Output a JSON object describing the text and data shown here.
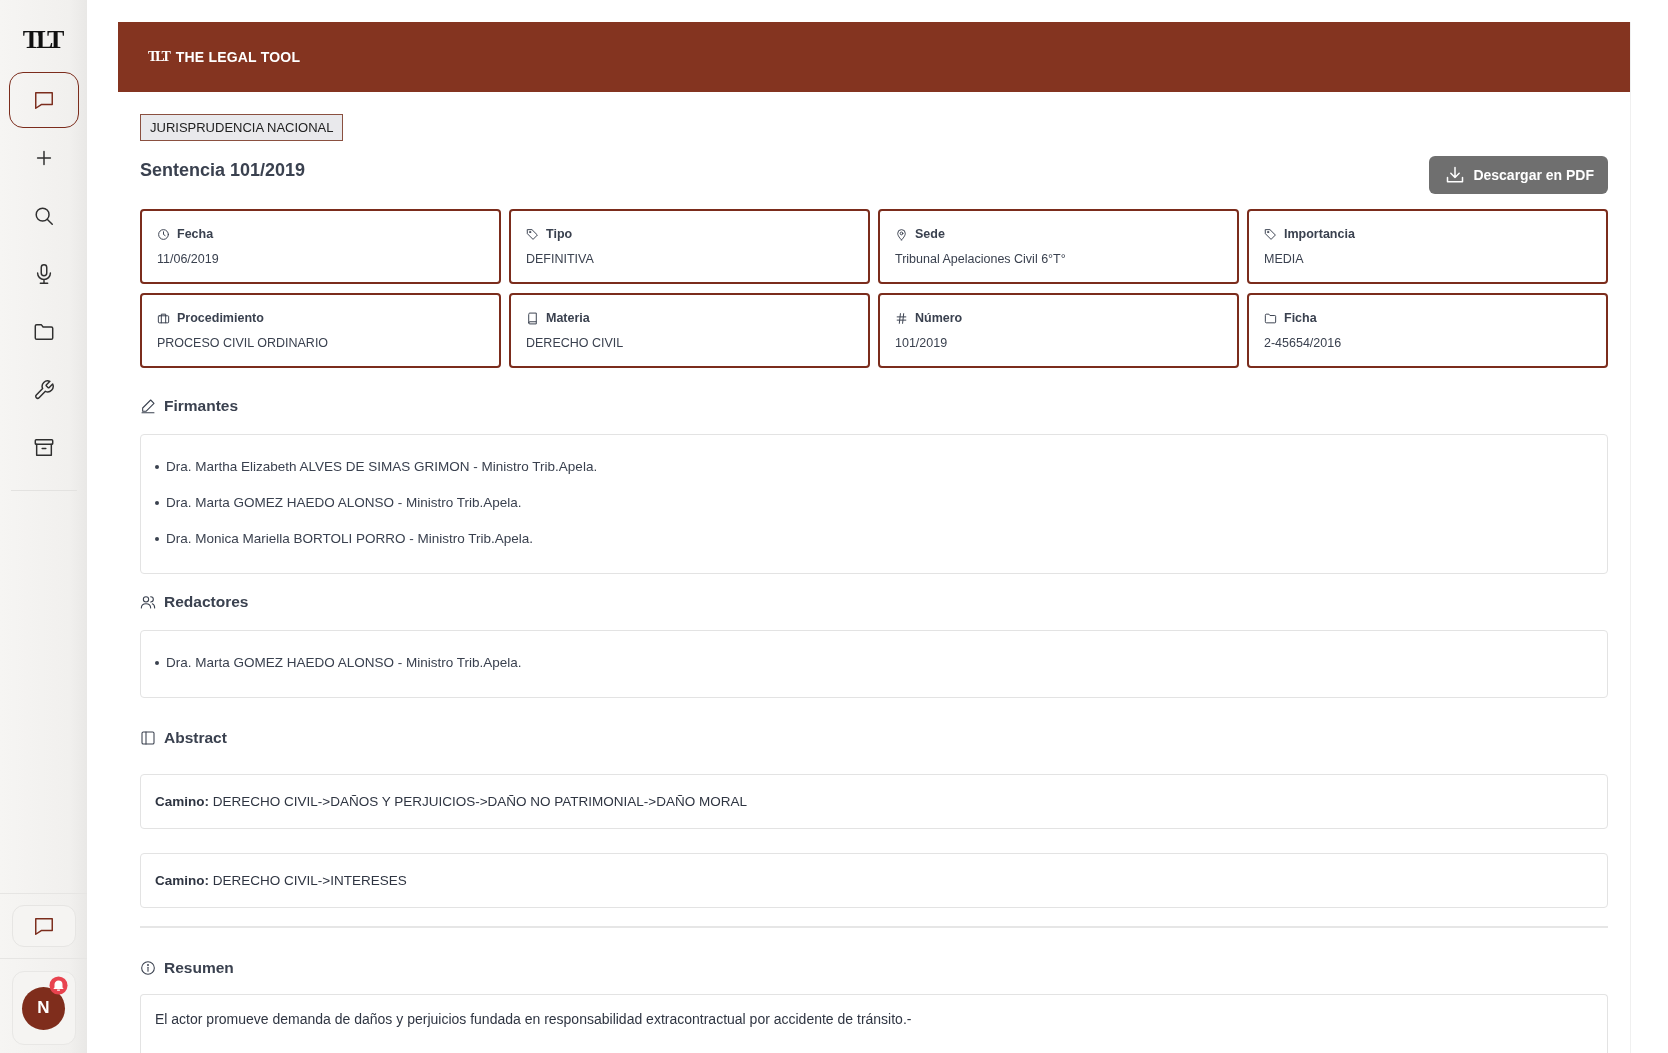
{
  "sidebar": {
    "logo": "TLT",
    "items": [
      {
        "selected": true
      },
      {
        "selected": false
      },
      {
        "selected": false
      },
      {
        "selected": false
      },
      {
        "selected": false
      },
      {
        "selected": false
      },
      {
        "selected": false
      }
    ]
  },
  "sidebar_footer": {
    "avatar_initial": "N",
    "notification": true
  },
  "header": {
    "logo_mark": "TLT",
    "title": "THE LEGAL TOOL"
  },
  "category": "JURISPRUDENCIA NACIONAL",
  "title": "Sentencia 101/2019",
  "download_button": "Descargar en PDF",
  "fields": [
    {
      "label": "Fecha",
      "value": "11/06/2019"
    },
    {
      "label": "Tipo",
      "value": "DEFINITIVA"
    },
    {
      "label": "Sede",
      "value": "Tribunal Apelaciones Civil 6°T°"
    },
    {
      "label": "Importancia",
      "value": "MEDIA"
    },
    {
      "label": "Procedimiento",
      "value": "PROCESO CIVIL ORDINARIO"
    },
    {
      "label": "Materia",
      "value": "DERECHO CIVIL"
    },
    {
      "label": "Número",
      "value": "101/2019"
    },
    {
      "label": "Ficha",
      "value": "2-45654/2016"
    }
  ],
  "sections": [
    {
      "kind": "list",
      "title": "Firmantes",
      "items": [
        "Dra. Martha Elizabeth ALVES DE SIMAS GRIMON - Ministro Trib.Apela.",
        "Dra. Marta GOMEZ HAEDO ALONSO - Ministro Trib.Apela.",
        "Dra. Monica Mariella BORTOLI PORRO - Ministro Trib.Apela."
      ]
    },
    {
      "kind": "list",
      "title": "Redactores",
      "items": [
        "Dra. Marta GOMEZ HAEDO ALONSO - Ministro Trib.Apela."
      ]
    },
    {
      "kind": "paths",
      "title": "Abstract",
      "items": [
        "**Camino:** DERECHO CIVIL->DAÑOS Y PERJUICIOS->DAÑO NO PATRIMONIAL->DAÑO MORAL",
        "**Camino:** DERECHO CIVIL->INTERESES"
      ]
    },
    {
      "kind": "text",
      "title": "Resumen",
      "text": "El actor promueve demanda de daños y perjuicios fundada en responsabilidad extracontractual por accidente de tránsito.-"
    }
  ]
}
